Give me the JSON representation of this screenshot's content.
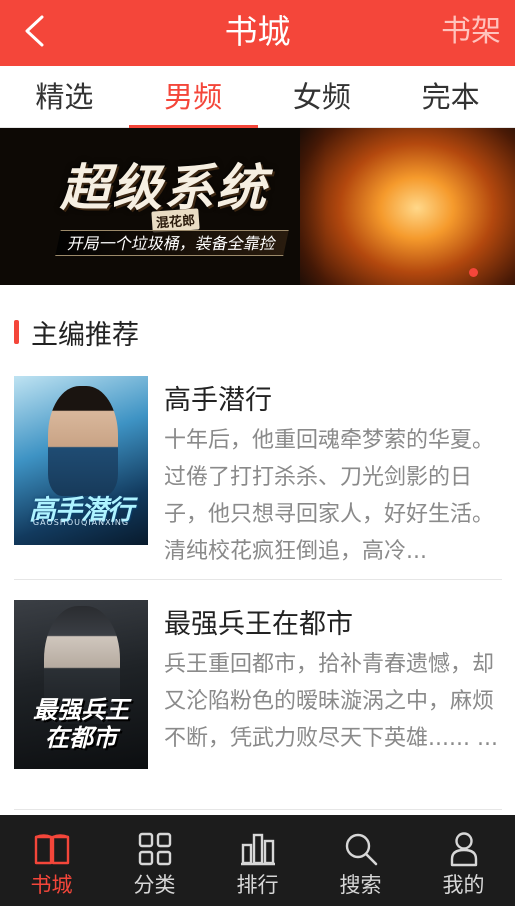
{
  "header": {
    "title": "书城",
    "right_link": "书架",
    "back_icon": "chevron-left-icon"
  },
  "tabs": [
    {
      "label": "精选",
      "active": false
    },
    {
      "label": "男频",
      "active": true
    },
    {
      "label": "女频",
      "active": false
    },
    {
      "label": "完本",
      "active": false
    }
  ],
  "banner": {
    "title": "超级系统",
    "author": "混花郎",
    "slogan": "开局一个垃圾桶，装备全靠捡",
    "slide_count": 1,
    "active_slide": 1
  },
  "section": {
    "title": "主编推荐"
  },
  "books": [
    {
      "title": "高手潜行",
      "description": "十年后，他重回魂牵梦萦的华夏。过倦了打打杀杀、刀光剑影的日子，他只想寻回家人，好好生活。清纯校花疯狂倒追，高冷...",
      "cover_title": "高手潜行",
      "cover_subtitle": "GAOSHOUQIANXING"
    },
    {
      "title": "最强兵王在都市",
      "description": "兵王重回都市，拾补青春遗憾，却又沦陷粉色的暧昧漩涡之中，麻烦不断，凭武力败尽天下英雄...... ...",
      "cover_title_line1": "最强兵王",
      "cover_title_line2": "在都市"
    }
  ],
  "bottom_nav": [
    {
      "label": "书城",
      "icon": "book-icon",
      "active": true
    },
    {
      "label": "分类",
      "icon": "grid-icon",
      "active": false
    },
    {
      "label": "排行",
      "icon": "ranking-icon",
      "active": false
    },
    {
      "label": "搜索",
      "icon": "search-icon",
      "active": false
    },
    {
      "label": "我的",
      "icon": "person-icon",
      "active": false
    }
  ],
  "colors": {
    "accent": "#f4463a",
    "nav_background": "#1c1c1c",
    "description_text": "#8a8a8a"
  }
}
